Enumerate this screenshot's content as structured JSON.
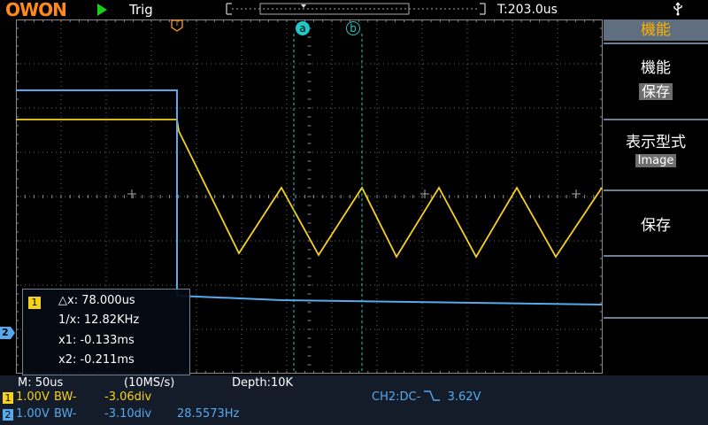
{
  "header": {
    "brand": "OWON",
    "trigger_label": "Trig",
    "time_position": "T:203.0us"
  },
  "side_menu": {
    "title": "機能",
    "items": [
      {
        "label": "機能",
        "value": "保存"
      },
      {
        "label": "表示型式",
        "value": "Image"
      },
      {
        "label": "保存",
        "value": ""
      }
    ]
  },
  "markers": {
    "trigger": "T",
    "cursor_a": "a",
    "cursor_b": "b",
    "ch2": "2"
  },
  "cursor_info": {
    "channel": "1",
    "delta_x": "△x: 78.000us",
    "inv_x": "1/x: 12.82KHz",
    "x1": "x1: -0.133ms",
    "x2": "x2: -0.211ms"
  },
  "status": {
    "timebase": "M: 50us",
    "sample_rate": "(10MS/s)",
    "depth": "Depth:10K",
    "ch1": {
      "badge": "1",
      "scale": "1.00V",
      "bw": "BW-",
      "offset": "-3.06div"
    },
    "ch2": {
      "badge": "2",
      "scale": "1.00V",
      "bw": "BW-",
      "offset": "-3.10div",
      "freq": "28.5573Hz"
    },
    "trigger_info": {
      "prefix": "CH2:DC-",
      "level": "3.62V"
    }
  },
  "colors": {
    "ch1": "#f6d21d",
    "ch2": "#55aaee",
    "cursor": "#22c8c8",
    "trigger": "#ff9a20",
    "grid": "#8a8a8a"
  }
}
